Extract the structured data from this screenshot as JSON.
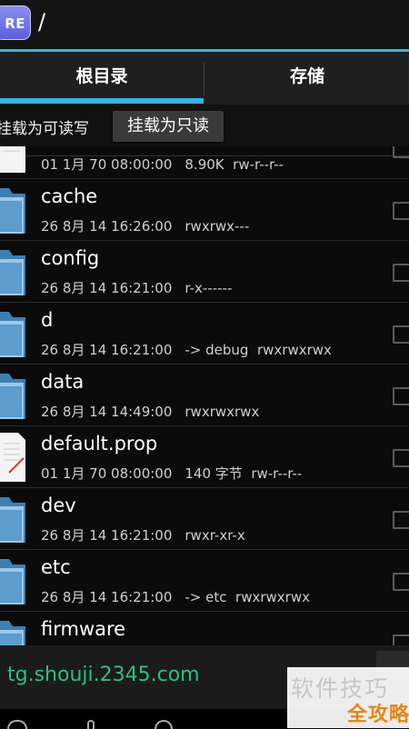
{
  "header": {
    "path": "/",
    "app_icon_text": "RE"
  },
  "tabs": [
    {
      "label": "根目录",
      "active": true
    },
    {
      "label": "存储",
      "active": false
    }
  ],
  "mount": {
    "status_label": "挂载为可读写",
    "button_label": "挂载为只读"
  },
  "files": [
    {
      "name": "",
      "date": "01 1月 70 08:00:00",
      "detail": "8.90K  rw-r--r--",
      "type": "file"
    },
    {
      "name": "cache",
      "date": "26 8月 14 16:26:00",
      "detail": "rwxrwx---",
      "type": "folder"
    },
    {
      "name": "config",
      "date": "26 8月 14 16:21:00",
      "detail": "r-x------",
      "type": "folder"
    },
    {
      "name": "d",
      "date": "26 8月 14 16:21:00",
      "detail": "-> debug  rwxrwxrwx",
      "type": "folder"
    },
    {
      "name": "data",
      "date": "26 8月 14 14:49:00",
      "detail": "rwxrwxrwx",
      "type": "folder"
    },
    {
      "name": "default.prop",
      "date": "01 1月 70 08:00:00",
      "detail": "140 字节  rw-r--r--",
      "type": "file"
    },
    {
      "name": "dev",
      "date": "26 8月 14 16:21:00",
      "detail": "rwxr-xr-x",
      "type": "folder"
    },
    {
      "name": "etc",
      "date": "26 8月 14 16:21:00",
      "detail": "-> etc  rwxrwxrwx",
      "type": "folder"
    },
    {
      "name": "firmware",
      "date": "",
      "detail": "",
      "type": "folder"
    }
  ],
  "banner": {
    "url": "tg.shouji.2345.com"
  },
  "watermark": {
    "line1": "软件技巧",
    "line2": "全攻略"
  },
  "colors": {
    "accent": "#33b5e5",
    "banner_text": "#2fbf7f",
    "watermark_orange": "#e2871b"
  }
}
